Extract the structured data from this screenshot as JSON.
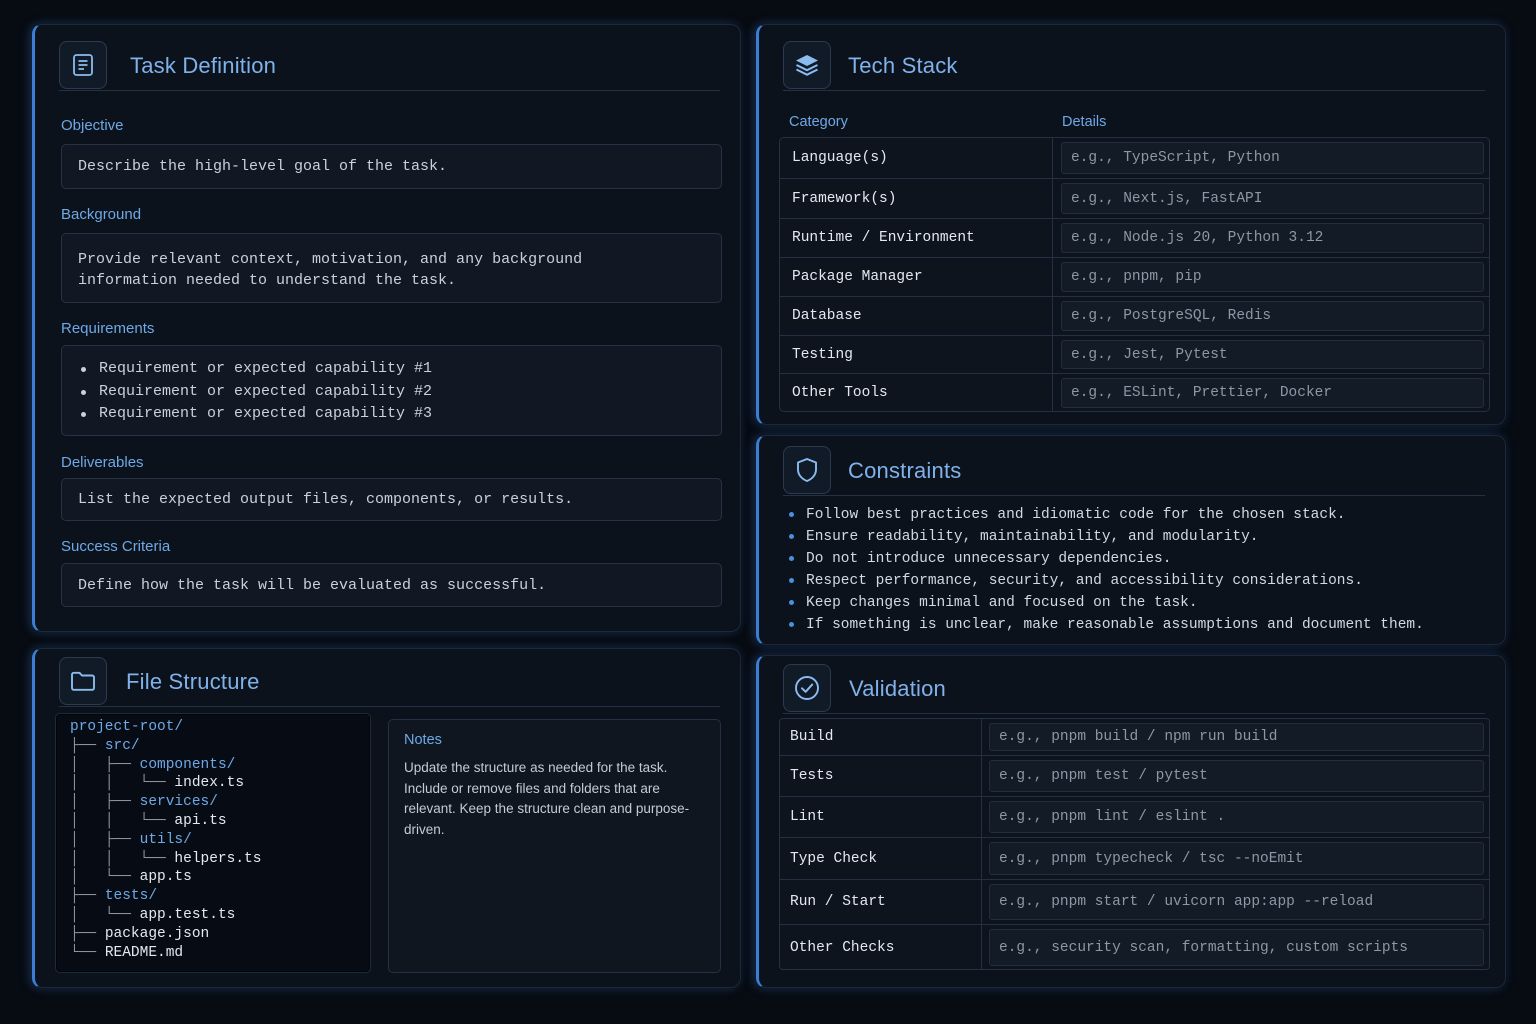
{
  "task": {
    "title": "Task Definition",
    "icon": "document-icon",
    "objective": {
      "label": "Objective",
      "value": "Describe the high-level goal of the task."
    },
    "background": {
      "label": "Background",
      "line1": "Provide relevant context, motivation, and any background",
      "line2": "information needed to understand the task."
    },
    "requirements": {
      "label": "Requirements",
      "items": [
        "Requirement or expected capability #1",
        "Requirement or expected capability #2",
        "Requirement or expected capability #3"
      ]
    },
    "deliverables": {
      "label": "Deliverables",
      "value": "List the expected output files, components, or results."
    },
    "success": {
      "label": "Success Criteria",
      "value": "Define how the task will be evaluated as successful."
    }
  },
  "tech": {
    "title": "Tech Stack",
    "icon": "layers-icon",
    "headers": {
      "category": "Category",
      "details": "Details"
    },
    "rows": [
      {
        "category": "Language(s)",
        "value": "e.g., TypeScript, Python"
      },
      {
        "category": "Framework(s)",
        "value": "e.g., Next.js, FastAPI"
      },
      {
        "category": "Runtime / Environment",
        "value": "e.g., Node.js 20, Python 3.12"
      },
      {
        "category": "Package Manager",
        "value": "e.g., pnpm, pip"
      },
      {
        "category": "Database",
        "value": "e.g., PostgreSQL, Redis"
      },
      {
        "category": "Testing",
        "value": "e.g., Jest, Pytest"
      },
      {
        "category": "Other Tools",
        "value": "e.g., ESLint, Prettier, Docker"
      }
    ]
  },
  "constraints": {
    "title": "Constraints",
    "icon": "shield-icon",
    "items": [
      "Follow best practices and idiomatic code for the chosen stack.",
      "Ensure readability, maintainability, and modularity.",
      "Do not introduce unnecessary dependencies.",
      "Respect performance, security, and accessibility considerations.",
      "Keep changes minimal and focused on the task.",
      "If something is unclear, make reasonable assumptions and document them."
    ]
  },
  "files": {
    "title": "File Structure",
    "icon": "folder-icon",
    "tree": [
      {
        "guide": "",
        "name": "project-root/",
        "dir": true
      },
      {
        "guide": "├── ",
        "name": "src/",
        "dir": true
      },
      {
        "guide": "│   ├── ",
        "name": "components/",
        "dir": true
      },
      {
        "guide": "│   │   └── ",
        "name": "index.ts",
        "dir": false
      },
      {
        "guide": "│   ├── ",
        "name": "services/",
        "dir": true
      },
      {
        "guide": "│   │   └── ",
        "name": "api.ts",
        "dir": false
      },
      {
        "guide": "│   ├── ",
        "name": "utils/",
        "dir": true
      },
      {
        "guide": "│   │   └── ",
        "name": "helpers.ts",
        "dir": false
      },
      {
        "guide": "│   └── ",
        "name": "app.ts",
        "dir": false
      },
      {
        "guide": "├── ",
        "name": "tests/",
        "dir": true
      },
      {
        "guide": "│   └── ",
        "name": "app.test.ts",
        "dir": false
      },
      {
        "guide": "├── ",
        "name": "package.json",
        "dir": false
      },
      {
        "guide": "└── ",
        "name": "README.md",
        "dir": false
      }
    ],
    "notes": {
      "title": "Notes",
      "body": "Update the structure as needed for the task. Include or remove files and folders that are relevant. Keep the structure clean and purpose-driven."
    }
  },
  "validation": {
    "title": "Validation",
    "icon": "check-circle-icon",
    "rows": [
      {
        "category": "Build",
        "value": "e.g., pnpm build / npm run build"
      },
      {
        "category": "Tests",
        "value": "e.g., pnpm test / pytest"
      },
      {
        "category": "Lint",
        "value": "e.g., pnpm lint / eslint ."
      },
      {
        "category": "Type Check",
        "value": "e.g., pnpm typecheck / tsc --noEmit"
      },
      {
        "category": "Run / Start",
        "value": "e.g., pnpm start / uvicorn app:app --reload"
      },
      {
        "category": "Other Checks",
        "value": "e.g., security scan, formatting, custom scripts"
      }
    ]
  },
  "colors": {
    "accent": "#3b7fd4",
    "label": "#6ea8e6",
    "title": "#7fb2ea",
    "background": "#070b12",
    "panel": "#0c121c"
  }
}
